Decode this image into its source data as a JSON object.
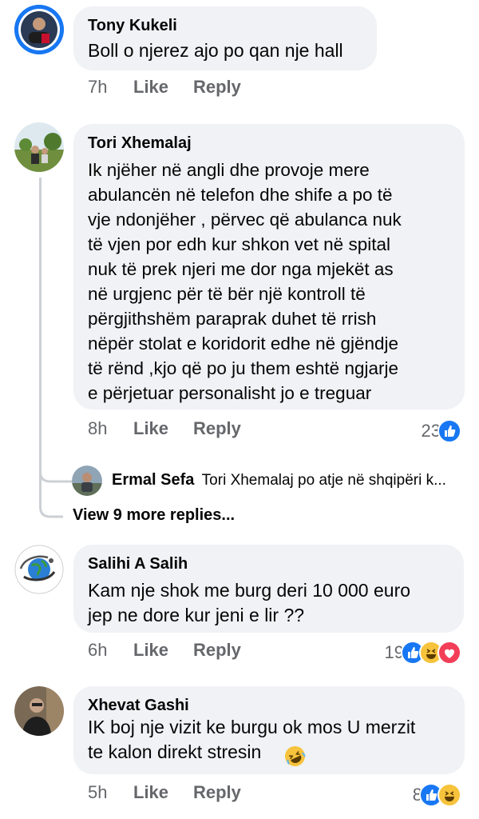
{
  "comments": [
    {
      "name": "Tony Kukeli",
      "text": "Boll o njerez ajo po qan nje hall",
      "time": "7h",
      "like": "Like",
      "reply": "Reply"
    },
    {
      "name": "Tori Xhemalaj",
      "text": "Ik njëher në angli dhe provoje mere\nabulancën në telefon dhe shife a po të\nvje ndonjëher , përvec që abulanca nuk\ntë vjen por edh kur shkon vet në spital\nnuk të prek njeri me dor nga  mjekët  as\nnë urgjenc për të bër  një kontroll të\npërgjithshëm  paraprak  duhet të rrish\nnëpër stolat e koridorit edhe në gjëndje\ntë rënd  ,kjo që po ju them eshtë ngjarje\n e  përjetuar personalisht jo e treguar",
      "time": "8h",
      "like": "Like",
      "reply": "Reply",
      "reaction_count": "23"
    },
    {
      "name": "Salihi A Salih",
      "text": "Kam nje shok me burg deri 10 000 euro\njep ne dore kur jeni e lir ??",
      "time": "6h",
      "like": "Like",
      "reply": "Reply",
      "reaction_count": "19"
    },
    {
      "name": "Xhevat Gashi",
      "text": "IK boj nje vizit ke burgu ok mos U merzit\nte kalon direkt stresin",
      "time": "5h",
      "like": "Like",
      "reply": "Reply",
      "reaction_count": "8"
    }
  ],
  "reply_preview": {
    "name": "Ermal Sefa",
    "text": "Tori Xhemalaj po atje në shqipëri k..."
  },
  "view_more": "View 9 more replies...",
  "colors": {
    "bubble": "#f0f2f5",
    "meta": "#65676b",
    "like_blue": "#1877f2",
    "haha_yellow": "#f7c33c",
    "love_red": "#f33e58"
  }
}
